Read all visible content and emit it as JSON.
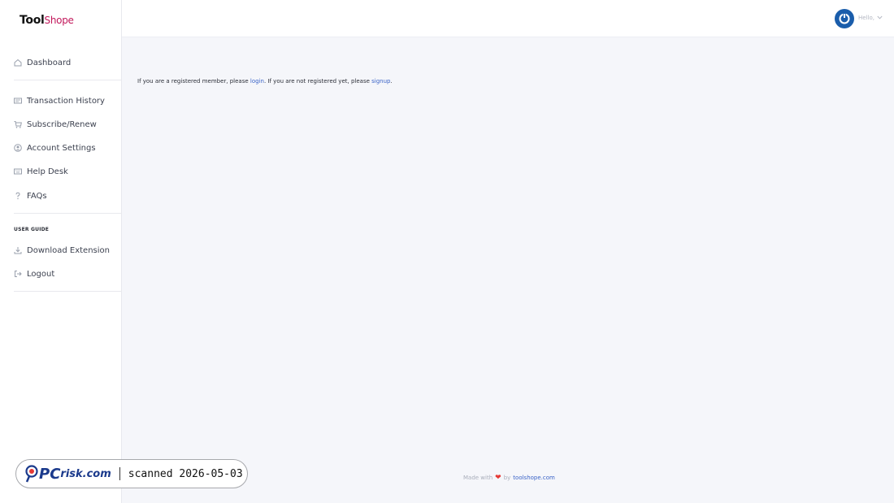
{
  "logo": {
    "part1": "Tool",
    "part2": "Shope"
  },
  "sidebar": {
    "items": [
      {
        "label": "Dashboard",
        "icon": "home-icon"
      },
      {
        "label": "Transaction History",
        "icon": "id-card-icon"
      },
      {
        "label": "Subscribe/Renew",
        "icon": "cart-icon"
      },
      {
        "label": "Account Settings",
        "icon": "user-circle-icon"
      },
      {
        "label": "Help Desk",
        "icon": "keyboard-icon"
      },
      {
        "label": "FAQs",
        "icon": "question-icon"
      }
    ],
    "section_label": "USER GUIDE",
    "guide_items": [
      {
        "label": "Download Extension",
        "icon": "download-icon"
      },
      {
        "label": "Logout",
        "icon": "logout-icon"
      }
    ]
  },
  "header": {
    "greeting": "Hello,"
  },
  "main": {
    "msg_part1": "If you are a registered member, please ",
    "login_link": "login",
    "msg_part2": ". If you are not registered yet, please ",
    "signup_link": "signup",
    "msg_part3": "."
  },
  "footer": {
    "made_with": "Made with",
    "by": "by",
    "site": "toolshope.com"
  },
  "watermark": {
    "brand": "PC",
    "brand_suffix": "risk.com",
    "scanned": "scanned 2026-05-03"
  },
  "colors": {
    "accent": "#3a63c7",
    "avatar": "#1a5dab",
    "heart": "#e53935"
  }
}
